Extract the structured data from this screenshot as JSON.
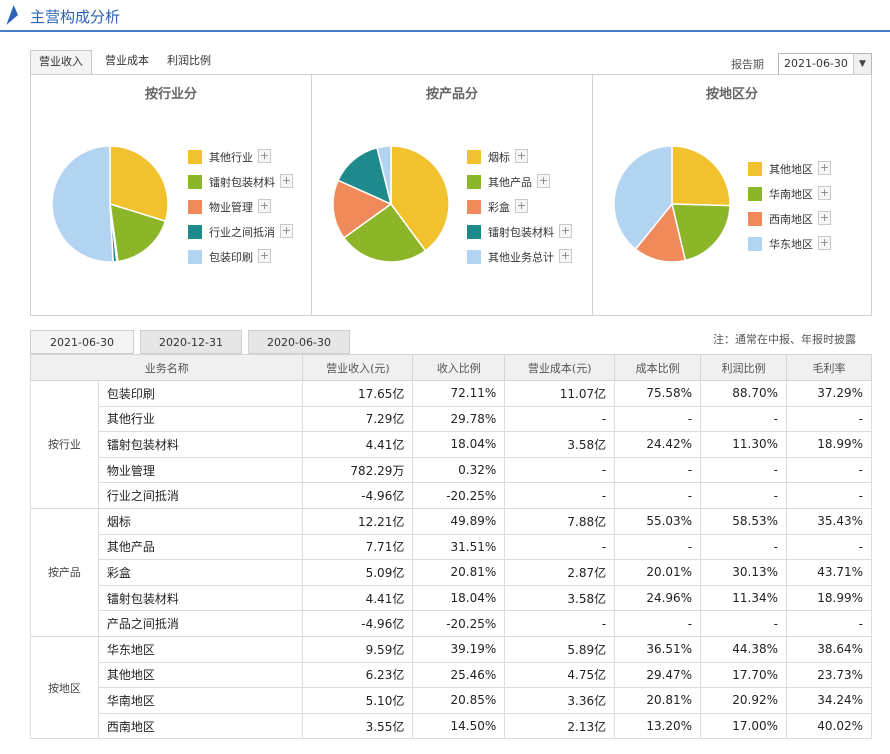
{
  "title": "主营构成分析",
  "main_tabs": [
    "营业收入",
    "营业成本",
    "利润比例"
  ],
  "report_label": "报告期",
  "report_value": "2021-06-30",
  "panels": [
    {
      "title": "按行业分",
      "legend": [
        "其他行业",
        "镭射包装材料",
        "物业管理",
        "行业之间抵消",
        "包装印刷"
      ],
      "slices": [
        {
          "label": "其他行业",
          "value": 0.2978,
          "color": "#f2c12e"
        },
        {
          "label": "镭射包装材料",
          "value": 0.1804,
          "color": "#8db52a"
        },
        {
          "label": "物业管理",
          "value": 0.0032,
          "color": "#f08a5a"
        },
        {
          "label": "行业之间抵消",
          "value": 0.01,
          "color": "#1e8a8c"
        },
        {
          "label": "包装印刷",
          "value": 0.5086,
          "color": "#b3d4f0"
        }
      ]
    },
    {
      "title": "按产品分",
      "legend": [
        "烟标",
        "其他产品",
        "彩盒",
        "镭射包装材料",
        "其他业务总计"
      ],
      "slices": [
        {
          "label": "烟标",
          "value": 0.3989,
          "color": "#f2c12e"
        },
        {
          "label": "其他产品",
          "value": 0.2519,
          "color": "#8db52a"
        },
        {
          "label": "彩盒",
          "value": 0.1663,
          "color": "#f08a5a"
        },
        {
          "label": "镭射包装材料",
          "value": 0.1441,
          "color": "#1e8a8c"
        },
        {
          "label": "其他业务总计",
          "value": 0.0388,
          "color": "#b3d4f0"
        }
      ]
    },
    {
      "title": "按地区分",
      "legend": [
        "其他地区",
        "华南地区",
        "西南地区",
        "华东地区"
      ],
      "slices": [
        {
          "label": "其他地区",
          "value": 0.2546,
          "color": "#f2c12e"
        },
        {
          "label": "华南地区",
          "value": 0.2085,
          "color": "#8db52a"
        },
        {
          "label": "西南地区",
          "value": 0.145,
          "color": "#f08a5a"
        },
        {
          "label": "华东地区",
          "value": 0.3919,
          "color": "#b3d4f0"
        }
      ]
    }
  ],
  "period_tabs": [
    "2021-06-30",
    "2020-12-31",
    "2020-06-30"
  ],
  "note": "注：通常在中报、年报时披露",
  "columns": [
    "业务名称",
    "营业收入(元)",
    "收入比例",
    "营业成本(元)",
    "成本比例",
    "利润比例",
    "毛利率"
  ],
  "groups": [
    {
      "name": "按行业",
      "rows": [
        [
          "包装印刷",
          "17.65亿",
          "72.11%",
          "11.07亿",
          "75.58%",
          "88.70%",
          "37.29%"
        ],
        [
          "其他行业",
          "7.29亿",
          "29.78%",
          "-",
          "-",
          "-",
          "-"
        ],
        [
          "镭射包装材料",
          "4.41亿",
          "18.04%",
          "3.58亿",
          "24.42%",
          "11.30%",
          "18.99%"
        ],
        [
          "物业管理",
          "782.29万",
          "0.32%",
          "-",
          "-",
          "-",
          "-"
        ],
        [
          "行业之间抵消",
          "-4.96亿",
          "-20.25%",
          "-",
          "-",
          "-",
          "-"
        ]
      ]
    },
    {
      "name": "按产品",
      "rows": [
        [
          "烟标",
          "12.21亿",
          "49.89%",
          "7.88亿",
          "55.03%",
          "58.53%",
          "35.43%"
        ],
        [
          "其他产品",
          "7.71亿",
          "31.51%",
          "-",
          "-",
          "-",
          "-"
        ],
        [
          "彩盒",
          "5.09亿",
          "20.81%",
          "2.87亿",
          "20.01%",
          "30.13%",
          "43.71%"
        ],
        [
          "镭射包装材料",
          "4.41亿",
          "18.04%",
          "3.58亿",
          "24.96%",
          "11.34%",
          "18.99%"
        ],
        [
          "产品之间抵消",
          "-4.96亿",
          "-20.25%",
          "-",
          "-",
          "-",
          "-"
        ]
      ]
    },
    {
      "name": "按地区",
      "rows": [
        [
          "华东地区",
          "9.59亿",
          "39.19%",
          "5.89亿",
          "36.51%",
          "44.38%",
          "38.64%"
        ],
        [
          "其他地区",
          "6.23亿",
          "25.46%",
          "4.75亿",
          "29.47%",
          "17.70%",
          "23.73%"
        ],
        [
          "华南地区",
          "5.10亿",
          "20.85%",
          "3.36亿",
          "20.81%",
          "20.92%",
          "34.24%"
        ],
        [
          "西南地区",
          "3.55亿",
          "14.50%",
          "2.13亿",
          "13.20%",
          "17.00%",
          "40.02%"
        ]
      ]
    }
  ]
}
